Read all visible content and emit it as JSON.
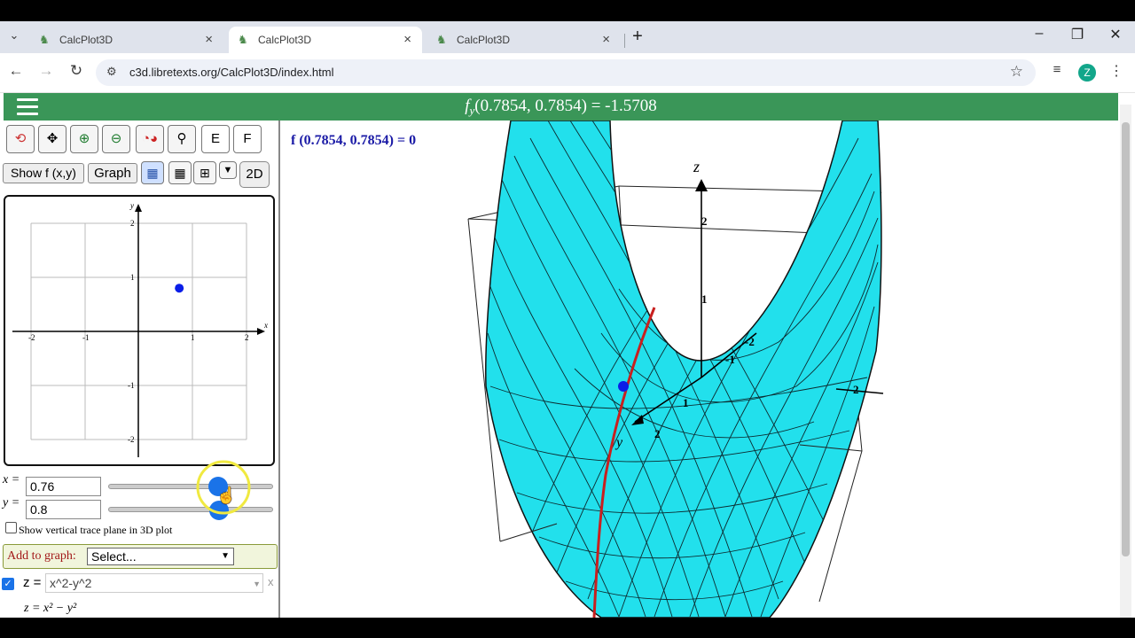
{
  "browser": {
    "tabs": [
      {
        "title": "CalcPlot3D",
        "active": false
      },
      {
        "title": "CalcPlot3D",
        "active": true
      },
      {
        "title": "CalcPlot3D",
        "active": false
      }
    ],
    "new_tab": "+",
    "close_tab": "×",
    "window_controls": {
      "minimize": "–",
      "restore": "❐",
      "close": "✕"
    },
    "url": "c3d.libretexts.org/CalcPlot3D/index.html",
    "avatar_letter": "Z"
  },
  "app": {
    "header_title_prefix": "f",
    "header_title_sub": "y",
    "header_title_value": "(0.7854, 0.7854) = -1.5708",
    "tool_buttons": {
      "e": "E",
      "f": "F"
    },
    "show_fxy_button": "Show f (x,y)",
    "graph_button": "Graph",
    "mode_button": "2D",
    "grid2d": {
      "x_ticks": [
        "-2",
        "-1",
        "1",
        "2"
      ],
      "y_ticks": [
        "2",
        "1",
        "-1",
        "-2"
      ],
      "x_axis_label": "x",
      "y_axis_label": "y",
      "point": {
        "x": 0.76,
        "y": 0.8
      }
    },
    "x_label": "x =",
    "x_value": "0.76",
    "y_label": "y =",
    "y_value": "0.8",
    "x_slider_fraction": 0.76,
    "trace_checkbox_label": "Show vertical trace plane in 3D plot",
    "add_to_graph_label": "Add to graph:",
    "add_to_graph_select": "Select...",
    "surface_label": "z =",
    "surface_input": "x^2-y^2",
    "surface_remove": "x",
    "surface_formula": "z = x² − y²",
    "plot_readout": "f (0.7854, 0.7854) = 0",
    "axis3d": {
      "z_label": "z",
      "z_ticks": [
        "2",
        "1"
      ],
      "y_label": "y",
      "y_ticks": [
        "1",
        "2"
      ],
      "x_ticks": [
        "-1",
        "-2"
      ],
      "right_tick": "2"
    }
  },
  "colors": {
    "header_green": "#3a9658",
    "surface_cyan": "#22e0ec",
    "trace_red": "#c8201f",
    "point_blue": "#0a1ee8",
    "readout_blue": "#1a1aa6",
    "add_row_bg": "#f1f5dc"
  }
}
